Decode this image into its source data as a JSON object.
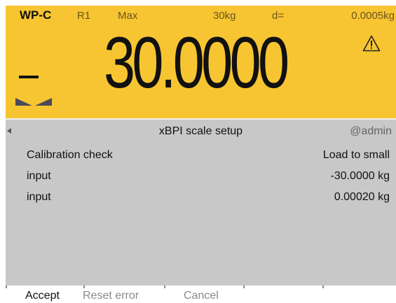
{
  "header": {
    "balance_id": "WP-C",
    "range": "R1",
    "max_label": "Max",
    "max_value": "30kg",
    "d_label": "d=",
    "d_value": "0.0005kg"
  },
  "weight": {
    "sign": "–",
    "value": "30.0000",
    "unit": ""
  },
  "icons": {
    "warning": "warning-triangle-icon",
    "stability": "stability-indicator-icon",
    "back": "back-arrow-icon"
  },
  "title_bar": {
    "title": "xBPI scale setup",
    "user": "@admin"
  },
  "rows": [
    {
      "label": "Calibration check",
      "value": "Load to small"
    },
    {
      "label": "input",
      "value": "-30.0000 kg"
    },
    {
      "label": "input",
      "value": "0.00020 kg"
    }
  ],
  "softkeys": {
    "accept": "Accept",
    "reset_error": "Reset error",
    "cancel": "Cancel"
  },
  "colors": {
    "display_bg": "#f7c531",
    "panel_bg": "#c8c8c8",
    "disabled_text": "#8a8a8a"
  }
}
